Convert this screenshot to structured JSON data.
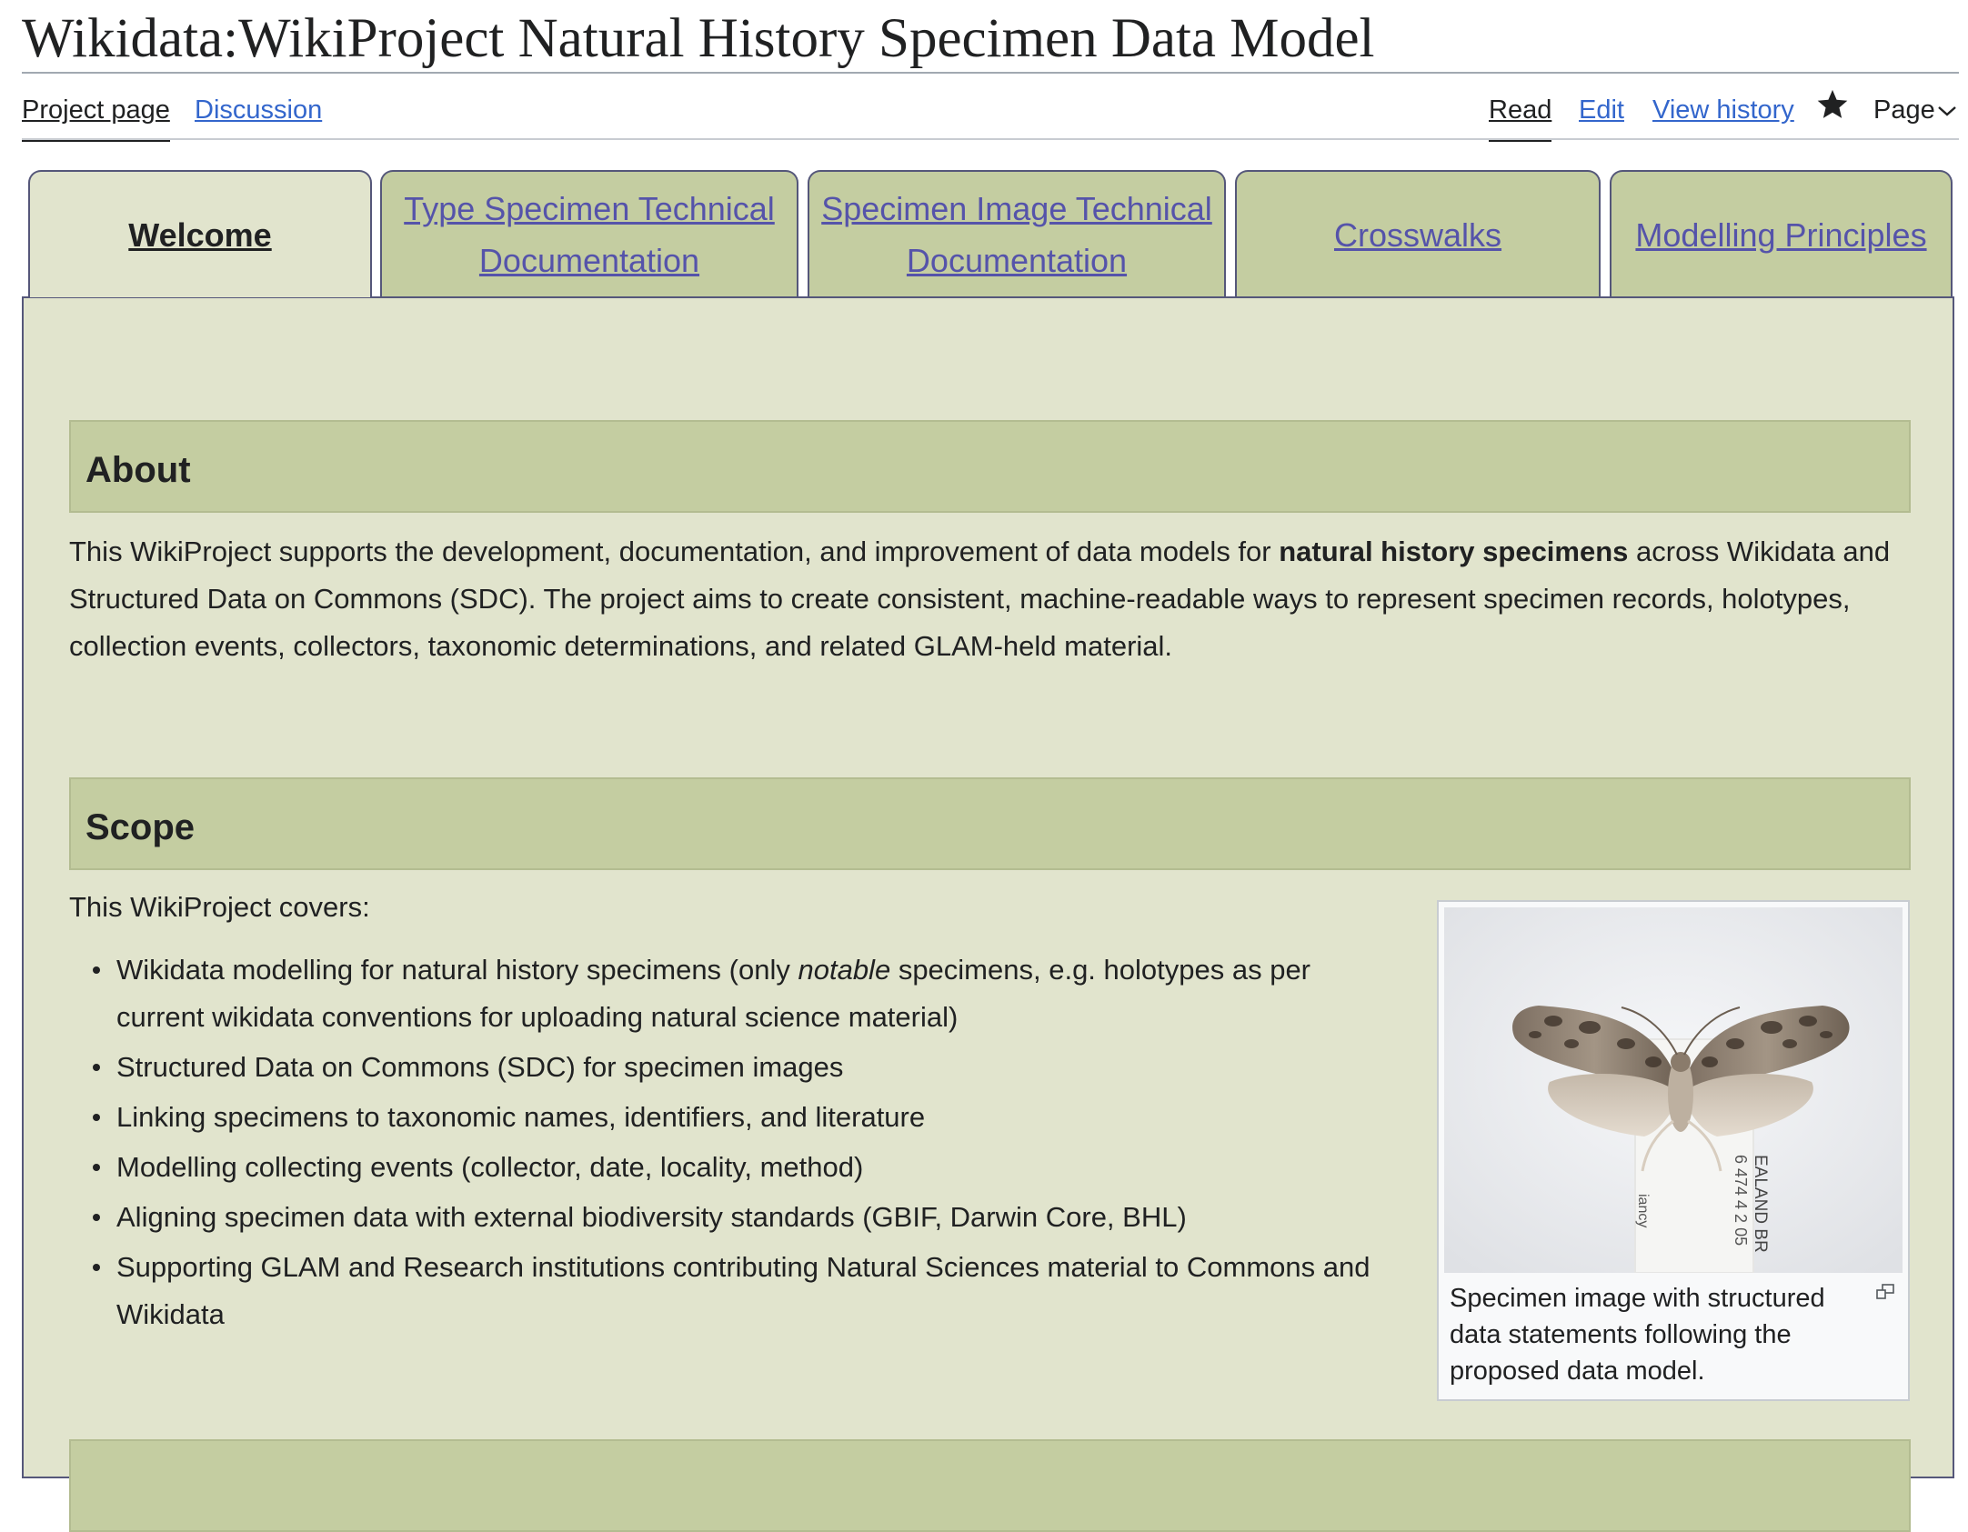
{
  "page": {
    "title": "Wikidata:WikiProject Natural History Specimen Data Model"
  },
  "nav": {
    "left": [
      {
        "label": "Project page",
        "active": true
      },
      {
        "label": "Discussion",
        "active": false
      }
    ],
    "right": [
      {
        "label": "Read",
        "active": true
      },
      {
        "label": "Edit",
        "active": false
      },
      {
        "label": "View history",
        "active": false
      }
    ],
    "watch_icon": "star-icon",
    "page_menu": {
      "label": "Page",
      "icon": "chevron-down-icon"
    }
  },
  "tabs": [
    {
      "label": "Welcome",
      "active": true
    },
    {
      "label": "Type Specimen Technical Documentation",
      "active": false
    },
    {
      "label": "Specimen Image Technical Documentation",
      "active": false
    },
    {
      "label": "Crosswalks",
      "active": false
    },
    {
      "label": "Modelling Principles",
      "active": false
    }
  ],
  "about": {
    "heading": "About",
    "text_before": "This WikiProject supports the development, documentation, and improvement of data models for ",
    "bold": "natural history specimens",
    "text_after": " across Wikidata and Structured Data on Commons (SDC). The project aims to create consistent, machine-readable ways to represent specimen records, holotypes, collection events, collectors, taxonomic determinations, and related GLAM-held material."
  },
  "scope": {
    "heading": "Scope",
    "intro": "This WikiProject covers:",
    "item1": {
      "before": "Wikidata modelling for natural history specimens (only ",
      "italic": "notable",
      "after": " specimens, e.g. holotypes as per current wikidata conventions for uploading natural science material)"
    },
    "items": [
      "Structured Data on Commons (SDC) for specimen images",
      "Linking specimens to taxonomic names, identifiers, and literature",
      "Modelling collecting events (collector, date, locality, method)",
      "Aligning specimen data with external biodiversity standards (GBIF, Darwin Core, BHL)",
      "Supporting GLAM and Research institutions contributing Natural Sciences material to Commons and Wikidata"
    ],
    "figure": {
      "caption": "Specimen image with structured data statements following the proposed data model.",
      "label_left": "iancy",
      "label_right": "EALAND BR",
      "label_right2": "6 474 4 2 05",
      "enlarge_icon": "enlarge-icon"
    }
  },
  "colors": {
    "link": "#3366cc",
    "tab_link": "#5553aa",
    "tab_bg": "#c4cda1",
    "panel_bg": "#e1e4cd",
    "border": "#55577a"
  }
}
